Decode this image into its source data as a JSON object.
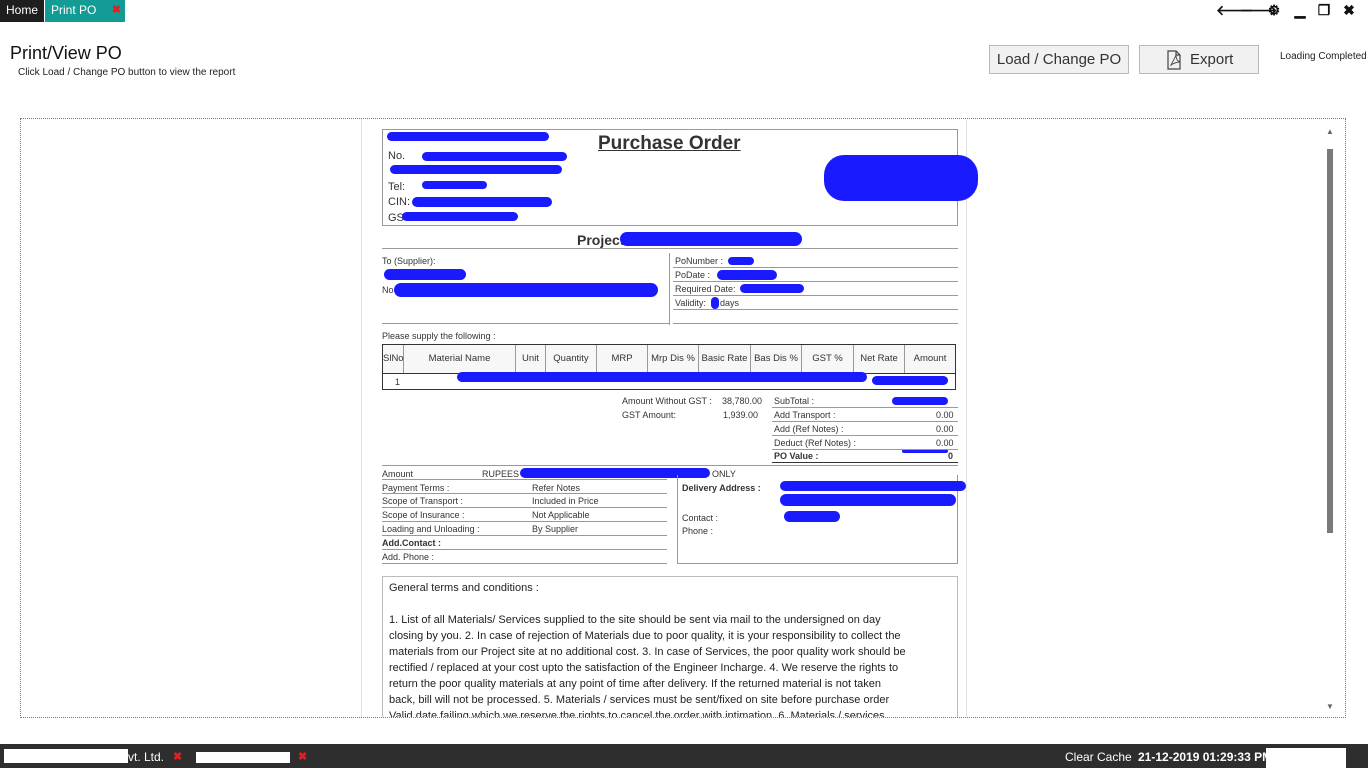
{
  "tabs": {
    "home": "Home",
    "print_po": "Print PO",
    "close": "✖"
  },
  "window_controls": {
    "back": "🡐",
    "forward": "🡒",
    "settings": "⚙",
    "minimize": "▁",
    "restore": "❐",
    "close": "✖"
  },
  "header": {
    "title": "Print/View PO",
    "subtitle": "Click Load / Change PO button to view the report",
    "load_button": "Load / Change PO",
    "export_button": "Export",
    "status": "Loading Completed"
  },
  "report": {
    "title": "Purchase Order",
    "company_lines": [
      "No.",
      "Tel:",
      "CIN:",
      "GST"
    ],
    "project_label": "Project:",
    "supplier_label": "To (Supplier):",
    "supplier_addr_prefix": "No",
    "po_fields": [
      "PoNumber :",
      "PoDate :",
      "Required Date:",
      "Validity:",
      "days"
    ],
    "supply_label": "Please supply the following :",
    "columns": [
      "SlNo",
      "Material Name",
      "Unit",
      "Quantity",
      "MRP",
      "Mrp Dis %",
      "Basic Rate",
      "Bas Dis %",
      "GST %",
      "Net Rate",
      "Amount"
    ],
    "row_slno": "1",
    "amount_without_gst_label": "Amount Without GST :",
    "amount_without_gst": "38,780.00",
    "gst_amount_label": "GST Amount:",
    "gst_amount": "1,939.00",
    "totals": [
      {
        "label": "SubTotal :",
        "value": ""
      },
      {
        "label": "Add Transport :",
        "value": "0.00"
      },
      {
        "label": "Add (Ref Notes) :",
        "value": "0.00"
      },
      {
        "label": "Deduct (Ref Notes) :",
        "value": "0.00"
      },
      {
        "label": "PO Value :",
        "value": "0"
      }
    ],
    "amount_words_label": "Amount",
    "amount_words_prefix": "RUPEES",
    "amount_words_suffix": "ONLY",
    "terms_rows": [
      {
        "label": "Payment Terms :",
        "value": "Refer Notes"
      },
      {
        "label": "Scope of Transport :",
        "value": "Included in Price"
      },
      {
        "label": "Scope of Insurance :",
        "value": "Not Applicable"
      },
      {
        "label": "Loading and Unloading :",
        "value": "By Supplier"
      },
      {
        "label": "Add.Contact :",
        "value": ""
      },
      {
        "label": "Add. Phone :",
        "value": ""
      }
    ],
    "delivery_label": "Delivery Address :",
    "contact_label": "Contact :",
    "phone_label": "Phone :",
    "general_terms_title": "General terms and conditions :",
    "general_terms_lines": [
      "1. List of all Materials/ Services supplied to the site should be sent via mail to the undersigned on day",
      "closing by you. 2. In case of rejection of Materials due to poor quality, it is your responsibility to collect the",
      "materials from our Project site at no additional cost. 3. In case of Services, the poor quality work should be",
      "rectified / replaced at your cost upto the satisfaction of the Engineer Incharge. 4. We reserve the rights to",
      "return the poor quality materials at any point of time after delivery. If the returned material is not taken",
      "back, bill will not be processed. 5. Materials / services must be sent/fixed on site before purchase order",
      "Valid date failing which we reserve the rights to cancel the order with intimation. 6. Materials / services"
    ]
  },
  "footer": {
    "tab1_suffix": "vt. Ltd.",
    "close": "✖",
    "clear_cache": "Clear Cache",
    "datetime": "21-12-2019 01:29:33 PM"
  },
  "colors": {
    "accent": "#139b95",
    "redaction": "#1a1aff",
    "dark_bar": "#2e2e2e"
  }
}
